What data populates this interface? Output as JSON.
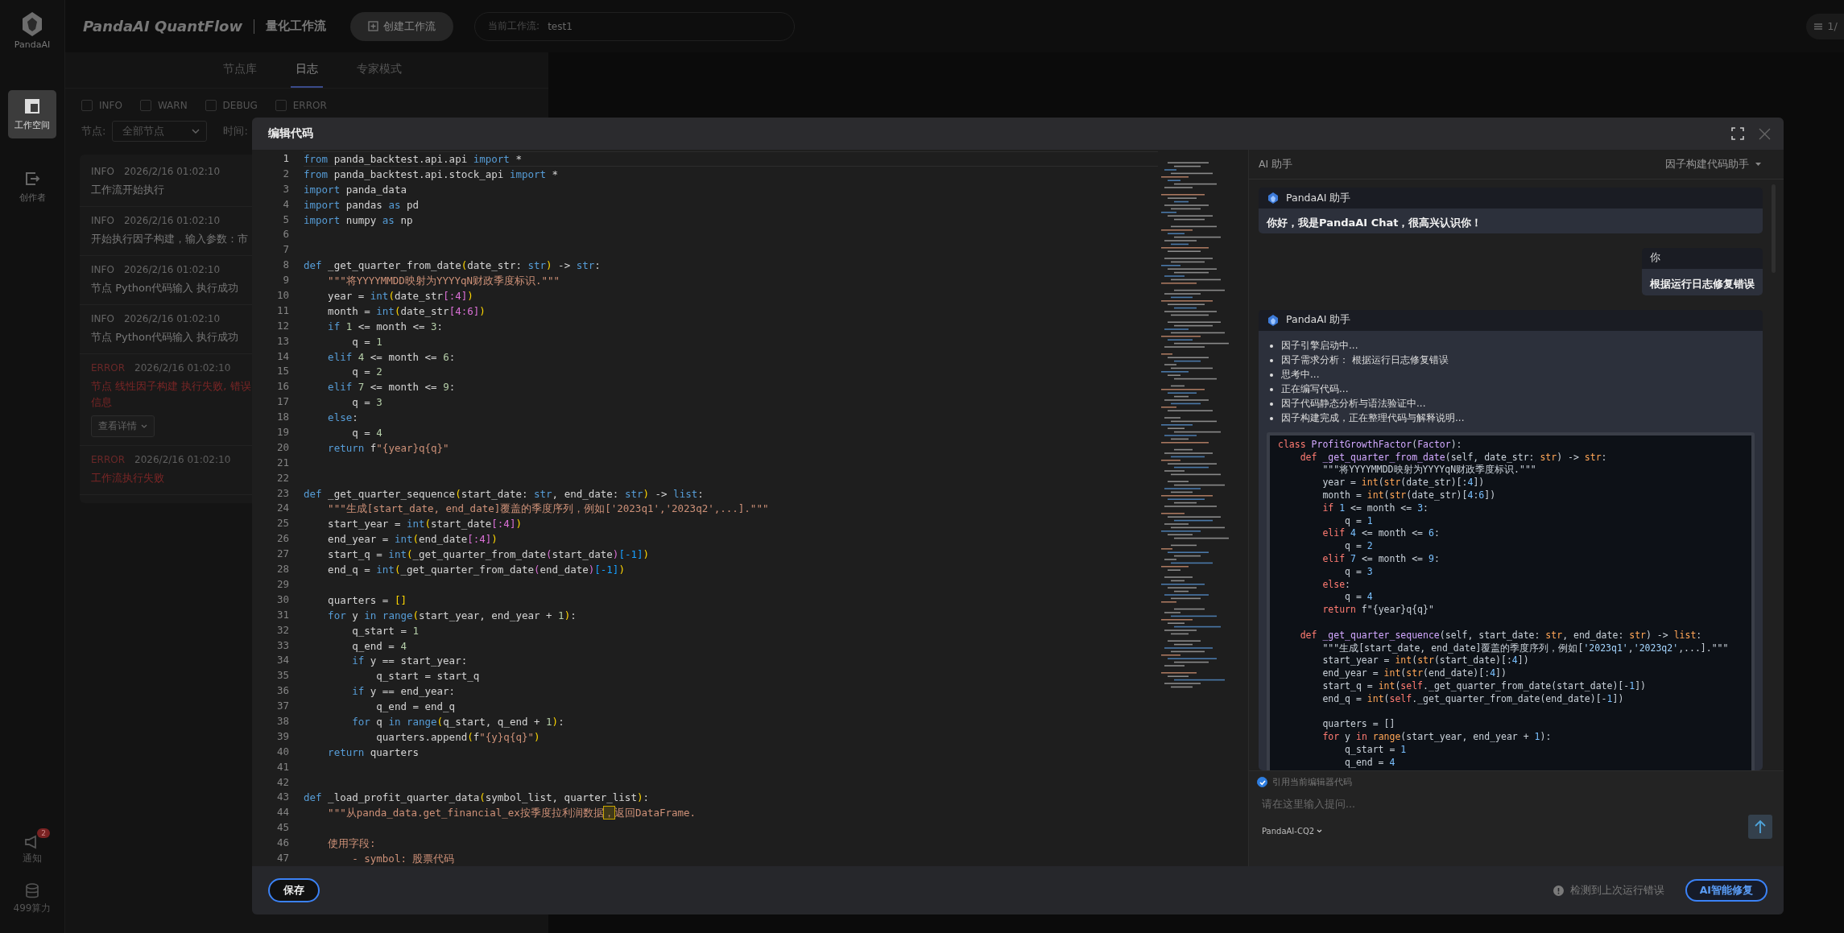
{
  "sidebar": {
    "logo_text": "PandaAI",
    "items": [
      {
        "label": "工作空间",
        "kind": "workspace",
        "selected": true
      },
      {
        "label": "创作者",
        "kind": "creator",
        "selected": false
      }
    ],
    "bottom": {
      "notify_label": "通知",
      "notify_badge": "2",
      "compute_label": "499算力"
    }
  },
  "header": {
    "app_title": "PandaAI QuantFlow",
    "section": "量化工作流",
    "create_button": "创建工作流",
    "workflow_field": {
      "label": "当前工作流:",
      "value": "test1"
    },
    "page_indicator": "1/"
  },
  "log_panel": {
    "tabs": [
      {
        "label": "节点库",
        "selected": false
      },
      {
        "label": "日志",
        "selected": true
      },
      {
        "label": "专家模式",
        "selected": false
      }
    ],
    "filters": [
      {
        "label": "INFO",
        "checked": false
      },
      {
        "label": "WARN",
        "checked": false
      },
      {
        "label": "DEBUG",
        "checked": false
      },
      {
        "label": "ERROR",
        "checked": false
      }
    ],
    "node_label": "节点:",
    "node_select": "全部节点",
    "time_label": "时间:",
    "entries": [
      {
        "kind": "info",
        "level": "INFO",
        "time": "2026/2/16 01:02:10",
        "message": "工作流开始执行"
      },
      {
        "kind": "info",
        "level": "INFO",
        "time": "2026/2/16 01:02:10",
        "message": "开始执行因子构建，输入参数：市"
      },
      {
        "kind": "info",
        "level": "INFO",
        "time": "2026/2/16 01:02:10",
        "message": "节点 Python代码输入 执行成功"
      },
      {
        "kind": "info",
        "level": "INFO",
        "time": "2026/2/16 01:02:10",
        "message": "节点 Python代码输入 执行成功"
      },
      {
        "kind": "error",
        "level": "ERROR",
        "time": "2026/2/16 01:02:10",
        "message": "节点 线性因子构建 执行失败, 错误信息",
        "button": "查看详情"
      },
      {
        "kind": "error",
        "level": "ERROR",
        "time": "2026/2/16 01:02:10",
        "message": "工作流执行失败"
      }
    ]
  },
  "modal": {
    "title": "编辑代码",
    "editor": {
      "lines": [
        {
          "number": "1",
          "current": true,
          "tokens": [
            {
              "text": "from",
              "kind": "kw"
            },
            {
              "text": " panda_backtest.api.api ",
              "kind": "plain"
            },
            {
              "text": "import",
              "kind": "kw"
            },
            {
              "text": " *",
              "kind": "plain"
            }
          ]
        },
        {
          "number": "2",
          "current": false,
          "tokens": [
            {
              "text": "from",
              "kind": "kw"
            },
            {
              "text": " panda_backtest.api.stock_api ",
              "kind": "plain"
            },
            {
              "text": "import",
              "kind": "kw"
            },
            {
              "text": " *",
              "kind": "plain"
            }
          ]
        },
        {
          "number": "3",
          "current": false,
          "tokens": [
            {
              "text": "import",
              "kind": "kw"
            },
            {
              "text": " panda_data",
              "kind": "plain"
            }
          ]
        },
        {
          "number": "4",
          "current": false,
          "tokens": [
            {
              "text": "import",
              "kind": "kw"
            },
            {
              "text": " pandas ",
              "kind": "plain"
            },
            {
              "text": "as",
              "kind": "kw"
            },
            {
              "text": " pd",
              "kind": "plain"
            }
          ]
        },
        {
          "number": "5",
          "current": false,
          "tokens": [
            {
              "text": "import",
              "kind": "kw"
            },
            {
              "text": " numpy ",
              "kind": "plain"
            },
            {
              "text": "as",
              "kind": "kw"
            },
            {
              "text": " np",
              "kind": "plain"
            }
          ]
        },
        {
          "number": "6",
          "current": false
        },
        {
          "number": "7",
          "current": false
        },
        {
          "number": "8",
          "current": false,
          "tokens": [
            {
              "text": "def",
              "kind": "kw"
            },
            {
              "text": " _get_quarter_from_date",
              "kind": "plain"
            },
            {
              "text": "(",
              "kind": "br1"
            },
            {
              "text": "date_str: ",
              "kind": "plain"
            },
            {
              "text": "str",
              "kind": "kw"
            },
            {
              "text": ")",
              "kind": "br1"
            },
            {
              "text": " -> ",
              "kind": "plain"
            },
            {
              "text": "str",
              "kind": "kw"
            },
            {
              "text": ":",
              "kind": "plain"
            }
          ]
        },
        {
          "number": "9",
          "current": false,
          "tokens": [
            {
              "text": "    \"\"\"将YYYYMMDD映射为YYYYqN财政季度标识.\"\"\"",
              "kind": "str"
            }
          ]
        },
        {
          "number": "10",
          "current": false,
          "tokens": [
            {
              "text": "    year = ",
              "kind": "plain"
            },
            {
              "text": "int",
              "kind": "kw"
            },
            {
              "text": "(",
              "kind": "br1"
            },
            {
              "text": "date_str",
              "kind": "plain"
            },
            {
              "text": "[:4]",
              "kind": "br2"
            },
            {
              "text": ")",
              "kind": "br1"
            }
          ]
        },
        {
          "number": "11",
          "current": false,
          "tokens": [
            {
              "text": "    month = ",
              "kind": "plain"
            },
            {
              "text": "int",
              "kind": "kw"
            },
            {
              "text": "(",
              "kind": "br1"
            },
            {
              "text": "date_str",
              "kind": "plain"
            },
            {
              "text": "[4:6]",
              "kind": "br2"
            },
            {
              "text": ")",
              "kind": "br1"
            }
          ]
        },
        {
          "number": "12",
          "current": false,
          "tokens": [
            {
              "text": "    if",
              "kind": "kw"
            },
            {
              "text": " 1",
              "kind": "num"
            },
            {
              "text": " <= month <= ",
              "kind": "plain"
            },
            {
              "text": "3",
              "kind": "num"
            },
            {
              "text": ":",
              "kind": "plain"
            }
          ]
        },
        {
          "number": "13",
          "current": false,
          "tokens": [
            {
              "text": "        q = ",
              "kind": "plain"
            },
            {
              "text": "1",
              "kind": "num"
            }
          ]
        },
        {
          "number": "14",
          "current": false,
          "tokens": [
            {
              "text": "    elif",
              "kind": "kw"
            },
            {
              "text": " 4",
              "kind": "num"
            },
            {
              "text": " <= month <= ",
              "kind": "plain"
            },
            {
              "text": "6",
              "kind": "num"
            },
            {
              "text": ":",
              "kind": "plain"
            }
          ]
        },
        {
          "number": "15",
          "current": false,
          "tokens": [
            {
              "text": "        q = ",
              "kind": "plain"
            },
            {
              "text": "2",
              "kind": "num"
            }
          ]
        },
        {
          "number": "16",
          "current": false,
          "tokens": [
            {
              "text": "    elif",
              "kind": "kw"
            },
            {
              "text": " 7",
              "kind": "num"
            },
            {
              "text": " <= month <= ",
              "kind": "plain"
            },
            {
              "text": "9",
              "kind": "num"
            },
            {
              "text": ":",
              "kind": "plain"
            }
          ]
        },
        {
          "number": "17",
          "current": false,
          "tokens": [
            {
              "text": "        q = ",
              "kind": "plain"
            },
            {
              "text": "3",
              "kind": "num"
            }
          ]
        },
        {
          "number": "18",
          "current": false,
          "tokens": [
            {
              "text": "    else",
              "kind": "kw"
            },
            {
              "text": ":",
              "kind": "plain"
            }
          ]
        },
        {
          "number": "19",
          "current": false,
          "tokens": [
            {
              "text": "        q = ",
              "kind": "plain"
            },
            {
              "text": "4",
              "kind": "num"
            }
          ]
        },
        {
          "number": "20",
          "current": false,
          "tokens": [
            {
              "text": "    return",
              "kind": "kw"
            },
            {
              "text": " f",
              "kind": "plain"
            },
            {
              "text": "\"{year}q{q}\"",
              "kind": "str"
            }
          ]
        },
        {
          "number": "21",
          "current": false
        },
        {
          "number": "22",
          "current": false
        },
        {
          "number": "23",
          "current": false,
          "tokens": [
            {
              "text": "def",
              "kind": "kw"
            },
            {
              "text": " _get_quarter_sequence",
              "kind": "plain"
            },
            {
              "text": "(",
              "kind": "br1"
            },
            {
              "text": "start_date: ",
              "kind": "plain"
            },
            {
              "text": "str",
              "kind": "kw"
            },
            {
              "text": ", end_date: ",
              "kind": "plain"
            },
            {
              "text": "str",
              "kind": "kw"
            },
            {
              "text": ")",
              "kind": "br1"
            },
            {
              "text": " -> ",
              "kind": "plain"
            },
            {
              "text": "list",
              "kind": "kw"
            },
            {
              "text": ":",
              "kind": "plain"
            }
          ]
        },
        {
          "number": "24",
          "current": false,
          "tokens": [
            {
              "text": "    \"\"\"生成[start_date, end_date]覆盖的季度序列，例如['2023q1','2023q2',...].\"\"\"",
              "kind": "str"
            }
          ]
        },
        {
          "number": "25",
          "current": false,
          "tokens": [
            {
              "text": "    start_year = ",
              "kind": "plain"
            },
            {
              "text": "int",
              "kind": "kw"
            },
            {
              "text": "(",
              "kind": "br1"
            },
            {
              "text": "start_date",
              "kind": "plain"
            },
            {
              "text": "[:4]",
              "kind": "br2"
            },
            {
              "text": ")",
              "kind": "br1"
            }
          ]
        },
        {
          "number": "26",
          "current": false,
          "tokens": [
            {
              "text": "    end_year = ",
              "kind": "plain"
            },
            {
              "text": "int",
              "kind": "kw"
            },
            {
              "text": "(",
              "kind": "br1"
            },
            {
              "text": "end_date",
              "kind": "plain"
            },
            {
              "text": "[:4]",
              "kind": "br2"
            },
            {
              "text": ")",
              "kind": "br1"
            }
          ]
        },
        {
          "number": "27",
          "current": false,
          "tokens": [
            {
              "text": "    start_q = ",
              "kind": "plain"
            },
            {
              "text": "int",
              "kind": "kw"
            },
            {
              "text": "(",
              "kind": "br1"
            },
            {
              "text": "_get_quarter_from_date",
              "kind": "plain"
            },
            {
              "text": "(",
              "kind": "br2"
            },
            {
              "text": "start_date",
              "kind": "plain"
            },
            {
              "text": ")",
              "kind": "br2"
            },
            {
              "text": "[-1]",
              "kind": "br3"
            },
            {
              "text": ")",
              "kind": "br1"
            }
          ]
        },
        {
          "number": "28",
          "current": false,
          "tokens": [
            {
              "text": "    end_q = ",
              "kind": "plain"
            },
            {
              "text": "int",
              "kind": "kw"
            },
            {
              "text": "(",
              "kind": "br1"
            },
            {
              "text": "_get_quarter_from_date",
              "kind": "plain"
            },
            {
              "text": "(",
              "kind": "br2"
            },
            {
              "text": "end_date",
              "kind": "plain"
            },
            {
              "text": ")",
              "kind": "br2"
            },
            {
              "text": "[-1]",
              "kind": "br3"
            },
            {
              "text": ")",
              "kind": "br1"
            }
          ]
        },
        {
          "number": "29",
          "current": false
        },
        {
          "number": "30",
          "current": false,
          "tokens": [
            {
              "text": "    quarters = ",
              "kind": "plain"
            },
            {
              "text": "[]",
              "kind": "br1"
            }
          ]
        },
        {
          "number": "31",
          "current": false,
          "tokens": [
            {
              "text": "    for",
              "kind": "kw"
            },
            {
              "text": " y ",
              "kind": "plain"
            },
            {
              "text": "in",
              "kind": "kw"
            },
            {
              "text": " range",
              "kind": "kw"
            },
            {
              "text": "(",
              "kind": "br1"
            },
            {
              "text": "start_year, end_year + ",
              "kind": "plain"
            },
            {
              "text": "1",
              "kind": "num"
            },
            {
              "text": ")",
              "kind": "br1"
            },
            {
              "text": ":",
              "kind": "plain"
            }
          ]
        },
        {
          "number": "32",
          "current": false,
          "tokens": [
            {
              "text": "        q_start = ",
              "kind": "plain"
            },
            {
              "text": "1",
              "kind": "num"
            }
          ]
        },
        {
          "number": "33",
          "current": false,
          "tokens": [
            {
              "text": "        q_end = ",
              "kind": "plain"
            },
            {
              "text": "4",
              "kind": "num"
            }
          ]
        },
        {
          "number": "34",
          "current": false,
          "tokens": [
            {
              "text": "        if",
              "kind": "kw"
            },
            {
              "text": " y == start_year:",
              "kind": "plain"
            }
          ]
        },
        {
          "number": "35",
          "current": false,
          "tokens": [
            {
              "text": "            q_start = start_q",
              "kind": "plain"
            }
          ]
        },
        {
          "number": "36",
          "current": false,
          "tokens": [
            {
              "text": "        if",
              "kind": "kw"
            },
            {
              "text": " y == end_year:",
              "kind": "plain"
            }
          ]
        },
        {
          "number": "37",
          "current": false,
          "tokens": [
            {
              "text": "            q_end = end_q",
              "kind": "plain"
            }
          ]
        },
        {
          "number": "38",
          "current": false,
          "tokens": [
            {
              "text": "        for",
              "kind": "kw"
            },
            {
              "text": " q ",
              "kind": "plain"
            },
            {
              "text": "in",
              "kind": "kw"
            },
            {
              "text": " range",
              "kind": "kw"
            },
            {
              "text": "(",
              "kind": "br1"
            },
            {
              "text": "q_start, q_end + ",
              "kind": "plain"
            },
            {
              "text": "1",
              "kind": "num"
            },
            {
              "text": ")",
              "kind": "br1"
            },
            {
              "text": ":",
              "kind": "plain"
            }
          ]
        },
        {
          "number": "39",
          "current": false,
          "tokens": [
            {
              "text": "            quarters.append",
              "kind": "plain"
            },
            {
              "text": "(",
              "kind": "br1"
            },
            {
              "text": "f",
              "kind": "plain"
            },
            {
              "text": "\"{y}q{q}\"",
              "kind": "str"
            },
            {
              "text": ")",
              "kind": "br1"
            }
          ]
        },
        {
          "number": "40",
          "current": false,
          "tokens": [
            {
              "text": "    return",
              "kind": "kw"
            },
            {
              "text": " quarters",
              "kind": "plain"
            }
          ]
        },
        {
          "number": "41",
          "current": false
        },
        {
          "number": "42",
          "current": false
        },
        {
          "number": "43",
          "current": false,
          "tokens": [
            {
              "text": "def",
              "kind": "kw"
            },
            {
              "text": " _load_profit_quarter_data",
              "kind": "plain"
            },
            {
              "text": "(",
              "kind": "br1"
            },
            {
              "text": "symbol_list, quarter_list",
              "kind": "plain"
            },
            {
              "text": ")",
              "kind": "br1"
            },
            {
              "text": ":",
              "kind": "plain"
            }
          ]
        },
        {
          "number": "44",
          "current": false,
          "tokens": [
            {
              "text": "    \"\"\"从panda_data.get_financial_ex按季度拉利润数据",
              "kind": "str"
            },
            {
              "text": "，",
              "kind": "strmark"
            },
            {
              "text": "返回DataFrame.",
              "kind": "str"
            }
          ]
        },
        {
          "number": "45",
          "current": false
        },
        {
          "number": "46",
          "current": false,
          "tokens": [
            {
              "text": "    使用字段:",
              "kind": "str"
            }
          ]
        },
        {
          "number": "47",
          "current": false,
          "tokens": [
            {
              "text": "        - symbol: 股票代码",
              "kind": "str"
            }
          ]
        }
      ]
    },
    "assistant": {
      "title": "AI 助手",
      "mode_select": "因子构建代码助手",
      "messages": [
        {
          "kind": "assistant",
          "author": "PandaAI 助手",
          "text": "你好，我是PandaAI Chat，很高兴认识你！"
        },
        {
          "kind": "user",
          "author": "你",
          "text": "根据运行日志修复错误"
        },
        {
          "kind": "assistant",
          "author": "PandaAI 助手",
          "bullets": [
            "因子引擎启动中...",
            "因子需求分析： 根据运行日志修复错误",
            "思考中...",
            "正在编写代码...",
            "因子代码静态分析与语法验证中...",
            "因子构建完成，正在整理代码与解释说明..."
          ],
          "code": [
            {
              "tokens": [
                {
                  "text": "class",
                  "kind": "akw"
                },
                {
                  "text": " ProfitGrowthFactor",
                  "kind": "acls"
                },
                {
                  "text": "(",
                  "kind": "aplain"
                },
                {
                  "text": "Factor",
                  "kind": "acls"
                },
                {
                  "text": "):",
                  "kind": "aplain"
                }
              ]
            },
            {
              "tokens": [
                {
                  "text": "    def",
                  "kind": "akw"
                },
                {
                  "text": " _get_quarter_from_date",
                  "kind": "acls"
                },
                {
                  "text": "(self, date_str: ",
                  "kind": "aplain"
                },
                {
                  "text": "str",
                  "kind": "abi"
                },
                {
                  "text": ") -> ",
                  "kind": "aplain"
                },
                {
                  "text": "str",
                  "kind": "abi"
                },
                {
                  "text": ":",
                  "kind": "aplain"
                }
              ]
            },
            {
              "tokens": [
                {
                  "text": "        \"\"\"将YYYYMMDD映射为YYYYqN财政季度标识.\"\"\"",
                  "kind": "aplain"
                }
              ]
            },
            {
              "tokens": [
                {
                  "text": "        year = ",
                  "kind": "aplain"
                },
                {
                  "text": "int",
                  "kind": "abi"
                },
                {
                  "text": "(",
                  "kind": "aplain"
                },
                {
                  "text": "str",
                  "kind": "abi"
                },
                {
                  "text": "(date_str)[:",
                  "kind": "aplain"
                },
                {
                  "text": "4",
                  "kind": "anum"
                },
                {
                  "text": "])",
                  "kind": "aplain"
                }
              ]
            },
            {
              "tokens": [
                {
                  "text": "        month = ",
                  "kind": "aplain"
                },
                {
                  "text": "int",
                  "kind": "abi"
                },
                {
                  "text": "(",
                  "kind": "aplain"
                },
                {
                  "text": "str",
                  "kind": "abi"
                },
                {
                  "text": "(date_str)[",
                  "kind": "aplain"
                },
                {
                  "text": "4",
                  "kind": "anum"
                },
                {
                  "text": ":",
                  "kind": "aplain"
                },
                {
                  "text": "6",
                  "kind": "anum"
                },
                {
                  "text": "])",
                  "kind": "aplain"
                }
              ]
            },
            {
              "tokens": [
                {
                  "text": "        if",
                  "kind": "akw"
                },
                {
                  "text": " 1",
                  "kind": "anum"
                },
                {
                  "text": " <= month <= ",
                  "kind": "aplain"
                },
                {
                  "text": "3",
                  "kind": "anum"
                },
                {
                  "text": ":",
                  "kind": "aplain"
                }
              ]
            },
            {
              "tokens": [
                {
                  "text": "            q = ",
                  "kind": "aplain"
                },
                {
                  "text": "1",
                  "kind": "anum"
                }
              ]
            },
            {
              "tokens": [
                {
                  "text": "        elif",
                  "kind": "akw"
                },
                {
                  "text": " 4",
                  "kind": "anum"
                },
                {
                  "text": " <= month <= ",
                  "kind": "aplain"
                },
                {
                  "text": "6",
                  "kind": "anum"
                },
                {
                  "text": ":",
                  "kind": "aplain"
                }
              ]
            },
            {
              "tokens": [
                {
                  "text": "            q = ",
                  "kind": "aplain"
                },
                {
                  "text": "2",
                  "kind": "anum"
                }
              ]
            },
            {
              "tokens": [
                {
                  "text": "        elif",
                  "kind": "akw"
                },
                {
                  "text": " 7",
                  "kind": "anum"
                },
                {
                  "text": " <= month <= ",
                  "kind": "aplain"
                },
                {
                  "text": "9",
                  "kind": "anum"
                },
                {
                  "text": ":",
                  "kind": "aplain"
                }
              ]
            },
            {
              "tokens": [
                {
                  "text": "            q = ",
                  "kind": "aplain"
                },
                {
                  "text": "3",
                  "kind": "anum"
                }
              ]
            },
            {
              "tokens": [
                {
                  "text": "        else",
                  "kind": "akw"
                },
                {
                  "text": ":",
                  "kind": "aplain"
                }
              ]
            },
            {
              "tokens": [
                {
                  "text": "            q = ",
                  "kind": "aplain"
                },
                {
                  "text": "4",
                  "kind": "anum"
                }
              ]
            },
            {
              "tokens": [
                {
                  "text": "        return",
                  "kind": "akw"
                },
                {
                  "text": " f\"{year}q{q}\"",
                  "kind": "aplain"
                }
              ]
            },
            {
              "blank": true
            },
            {
              "tokens": [
                {
                  "text": "    def",
                  "kind": "akw"
                },
                {
                  "text": " _get_quarter_sequence",
                  "kind": "acls"
                },
                {
                  "text": "(self, start_date: ",
                  "kind": "aplain"
                },
                {
                  "text": "str",
                  "kind": "abi"
                },
                {
                  "text": ", end_date: ",
                  "kind": "aplain"
                },
                {
                  "text": "str",
                  "kind": "abi"
                },
                {
                  "text": ") -> ",
                  "kind": "aplain"
                },
                {
                  "text": "list",
                  "kind": "abi"
                },
                {
                  "text": ":",
                  "kind": "aplain"
                }
              ]
            },
            {
              "tokens": [
                {
                  "text": "        \"\"\"生成[start_date, end_date]覆盖的季度序列，例如[",
                  "kind": "aplain"
                },
                {
                  "text": "'2023q1'",
                  "kind": "astr"
                },
                {
                  "text": ",",
                  "kind": "aplain"
                },
                {
                  "text": "'2023q2'",
                  "kind": "astr"
                },
                {
                  "text": ",...].\"\"\"",
                  "kind": "aplain"
                }
              ]
            },
            {
              "tokens": [
                {
                  "text": "        start_year = ",
                  "kind": "aplain"
                },
                {
                  "text": "int",
                  "kind": "abi"
                },
                {
                  "text": "(",
                  "kind": "aplain"
                },
                {
                  "text": "str",
                  "kind": "abi"
                },
                {
                  "text": "(start_date)[:",
                  "kind": "aplain"
                },
                {
                  "text": "4",
                  "kind": "anum"
                },
                {
                  "text": "])",
                  "kind": "aplain"
                }
              ]
            },
            {
              "tokens": [
                {
                  "text": "        end_year = ",
                  "kind": "aplain"
                },
                {
                  "text": "int",
                  "kind": "abi"
                },
                {
                  "text": "(",
                  "kind": "aplain"
                },
                {
                  "text": "str",
                  "kind": "abi"
                },
                {
                  "text": "(end_date)[:",
                  "kind": "aplain"
                },
                {
                  "text": "4",
                  "kind": "anum"
                },
                {
                  "text": "])",
                  "kind": "aplain"
                }
              ]
            },
            {
              "tokens": [
                {
                  "text": "        start_q = ",
                  "kind": "aplain"
                },
                {
                  "text": "int",
                  "kind": "abi"
                },
                {
                  "text": "(",
                  "kind": "aplain"
                },
                {
                  "text": "self",
                  "kind": "akw"
                },
                {
                  "text": "._get_quarter_from_date(start_date)[-",
                  "kind": "aplain"
                },
                {
                  "text": "1",
                  "kind": "anum"
                },
                {
                  "text": "])",
                  "kind": "aplain"
                }
              ]
            },
            {
              "tokens": [
                {
                  "text": "        end_q = ",
                  "kind": "aplain"
                },
                {
                  "text": "int",
                  "kind": "abi"
                },
                {
                  "text": "(",
                  "kind": "aplain"
                },
                {
                  "text": "self",
                  "kind": "akw"
                },
                {
                  "text": "._get_quarter_from_date(end_date)[-",
                  "kind": "aplain"
                },
                {
                  "text": "1",
                  "kind": "anum"
                },
                {
                  "text": "])",
                  "kind": "aplain"
                }
              ]
            },
            {
              "blank": true
            },
            {
              "tokens": [
                {
                  "text": "        quarters = []",
                  "kind": "aplain"
                }
              ]
            },
            {
              "tokens": [
                {
                  "text": "        for",
                  "kind": "akw"
                },
                {
                  "text": " y ",
                  "kind": "aplain"
                },
                {
                  "text": "in",
                  "kind": "akw"
                },
                {
                  "text": " range",
                  "kind": "abi"
                },
                {
                  "text": "(start_year, end_year + ",
                  "kind": "aplain"
                },
                {
                  "text": "1",
                  "kind": "anum"
                },
                {
                  "text": "):",
                  "kind": "aplain"
                }
              ]
            },
            {
              "tokens": [
                {
                  "text": "            q_start = ",
                  "kind": "aplain"
                },
                {
                  "text": "1",
                  "kind": "anum"
                }
              ]
            },
            {
              "tokens": [
                {
                  "text": "            q_end = ",
                  "kind": "aplain"
                },
                {
                  "text": "4",
                  "kind": "anum"
                }
              ]
            }
          ]
        }
      ],
      "use_editor_code": {
        "label": "引用当前编辑器代码",
        "checked": true
      },
      "input": {
        "placeholder": "请在这里输入提问..."
      },
      "model_select": "PandaAI-CQ2"
    },
    "footer": {
      "save_button": "保存",
      "warning": "检测到上次运行错误",
      "fix_button": "AI智能修复"
    }
  }
}
